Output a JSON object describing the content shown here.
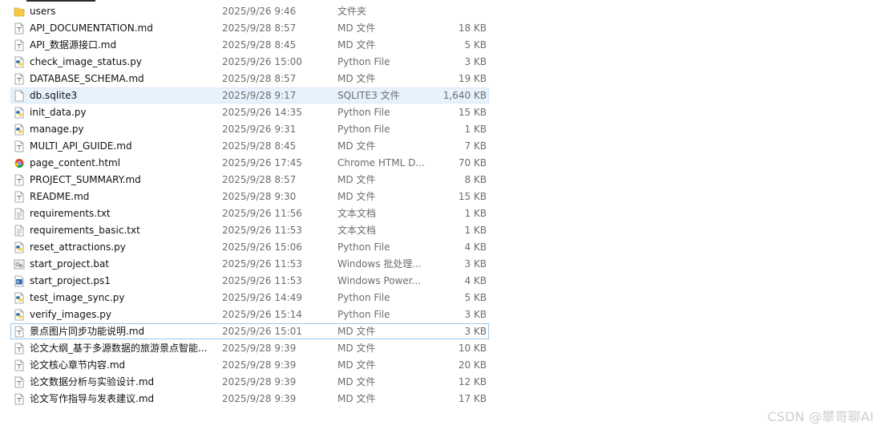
{
  "files": [
    {
      "icon": "folder-icon",
      "name": "users",
      "date": "2025/9/26 9:46",
      "type": "文件夹",
      "size": ""
    },
    {
      "icon": "md-file-icon",
      "name": "API_DOCUMENTATION.md",
      "date": "2025/9/28 8:57",
      "type": "MD 文件",
      "size": "18 KB"
    },
    {
      "icon": "md-file-icon",
      "name": "API_数据源接口.md",
      "date": "2025/9/28 8:45",
      "type": "MD 文件",
      "size": "5 KB"
    },
    {
      "icon": "python-file-icon",
      "name": "check_image_status.py",
      "date": "2025/9/26 15:00",
      "type": "Python File",
      "size": "3 KB"
    },
    {
      "icon": "md-file-icon",
      "name": "DATABASE_SCHEMA.md",
      "date": "2025/9/28 8:57",
      "type": "MD 文件",
      "size": "19 KB"
    },
    {
      "icon": "blank-file-icon",
      "name": "db.sqlite3",
      "date": "2025/9/28 9:17",
      "type": "SQLITE3 文件",
      "size": "1,640 KB"
    },
    {
      "icon": "python-file-icon",
      "name": "init_data.py",
      "date": "2025/9/26 14:35",
      "type": "Python File",
      "size": "15 KB"
    },
    {
      "icon": "python-file-icon",
      "name": "manage.py",
      "date": "2025/9/26 9:31",
      "type": "Python File",
      "size": "1 KB"
    },
    {
      "icon": "md-file-icon",
      "name": "MULTI_API_GUIDE.md",
      "date": "2025/9/28 8:45",
      "type": "MD 文件",
      "size": "7 KB"
    },
    {
      "icon": "chrome-html-icon",
      "name": "page_content.html",
      "date": "2025/9/26 17:45",
      "type": "Chrome HTML D...",
      "size": "70 KB"
    },
    {
      "icon": "md-file-icon",
      "name": "PROJECT_SUMMARY.md",
      "date": "2025/9/28 8:57",
      "type": "MD 文件",
      "size": "8 KB"
    },
    {
      "icon": "md-file-icon",
      "name": "README.md",
      "date": "2025/9/28 9:30",
      "type": "MD 文件",
      "size": "15 KB"
    },
    {
      "icon": "text-file-icon",
      "name": "requirements.txt",
      "date": "2025/9/26 11:56",
      "type": "文本文档",
      "size": "1 KB"
    },
    {
      "icon": "text-file-icon",
      "name": "requirements_basic.txt",
      "date": "2025/9/26 11:53",
      "type": "文本文档",
      "size": "1 KB"
    },
    {
      "icon": "python-file-icon",
      "name": "reset_attractions.py",
      "date": "2025/9/26 15:06",
      "type": "Python File",
      "size": "4 KB"
    },
    {
      "icon": "batch-file-icon",
      "name": "start_project.bat",
      "date": "2025/9/26 11:53",
      "type": "Windows 批处理...",
      "size": "3 KB"
    },
    {
      "icon": "powershell-file-icon",
      "name": "start_project.ps1",
      "date": "2025/9/26 11:53",
      "type": "Windows Power...",
      "size": "4 KB"
    },
    {
      "icon": "python-file-icon",
      "name": "test_image_sync.py",
      "date": "2025/9/26 14:49",
      "type": "Python File",
      "size": "5 KB"
    },
    {
      "icon": "python-file-icon",
      "name": "verify_images.py",
      "date": "2025/9/26 15:14",
      "type": "Python File",
      "size": "3 KB"
    },
    {
      "icon": "md-file-icon",
      "name": "景点图片同步功能说明.md",
      "date": "2025/9/26 15:01",
      "type": "MD 文件",
      "size": "3 KB"
    },
    {
      "icon": "md-file-icon",
      "name": "论文大纲_基于多源数据的旅游景点智能...",
      "date": "2025/9/28 9:39",
      "type": "MD 文件",
      "size": "10 KB"
    },
    {
      "icon": "md-file-icon",
      "name": "论文核心章节内容.md",
      "date": "2025/9/28 9:39",
      "type": "MD 文件",
      "size": "20 KB"
    },
    {
      "icon": "md-file-icon",
      "name": "论文数据分析与实验设计.md",
      "date": "2025/9/28 9:39",
      "type": "MD 文件",
      "size": "12 KB"
    },
    {
      "icon": "md-file-icon",
      "name": "论文写作指导与发表建议.md",
      "date": "2025/9/28 9:39",
      "type": "MD 文件",
      "size": "17 KB"
    }
  ],
  "selected_file": "db.sqlite3",
  "focused_file": "景点图片同步功能说明.md",
  "watermark": "CSDN @攀哥聊AI",
  "colors": {
    "selection_bg": "#e8f2fd",
    "focus_border": "#99c9ef",
    "meta_text": "#6d6d6d",
    "folder": "#f6c744",
    "python_blue": "#3572a5",
    "python_yellow": "#ffd43b"
  }
}
